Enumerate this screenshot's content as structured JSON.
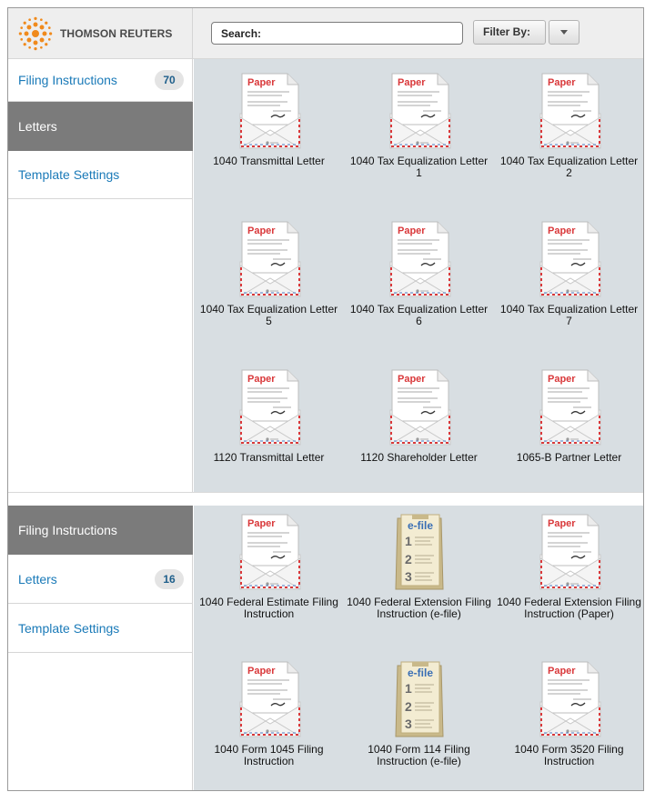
{
  "header": {
    "logo_text": "THOMSON REUTERS",
    "search_label": "Search:",
    "filter_label": "Filter By:"
  },
  "panel1": {
    "sidebar": [
      {
        "label": "Filing Instructions",
        "count": "70",
        "active": false
      },
      {
        "label": "Letters",
        "count": "",
        "active": true
      },
      {
        "label": "Template Settings",
        "count": "",
        "active": false
      }
    ],
    "tiles": [
      {
        "label": "1040 Transmittal Letter",
        "icon": "paper"
      },
      {
        "label": "1040 Tax Equalization Letter 1",
        "icon": "paper"
      },
      {
        "label": "1040 Tax Equalization Letter 2",
        "icon": "paper"
      },
      {
        "label": "1040 Tax Equalization Letter 5",
        "icon": "paper"
      },
      {
        "label": "1040 Tax Equalization Letter 6",
        "icon": "paper"
      },
      {
        "label": "1040 Tax Equalization Letter 7",
        "icon": "paper"
      },
      {
        "label": "1120 Transmittal Letter",
        "icon": "paper"
      },
      {
        "label": "1120 Shareholder Letter",
        "icon": "paper"
      },
      {
        "label": "1065-B Partner Letter",
        "icon": "paper"
      }
    ]
  },
  "panel2": {
    "sidebar": [
      {
        "label": "Filing Instructions",
        "count": "",
        "active": true
      },
      {
        "label": "Letters",
        "count": "16",
        "active": false
      },
      {
        "label": "Template Settings",
        "count": "",
        "active": false
      }
    ],
    "tiles": [
      {
        "label": "1040 Federal Estimate Filing Instruction",
        "icon": "paper"
      },
      {
        "label": "1040 Federal Extension Filing Instruction (e-file)",
        "icon": "efile"
      },
      {
        "label": "1040 Federal Extension Filing Instruction (Paper)",
        "icon": "paper"
      },
      {
        "label": "1040 Form 1045 Filing Instruction",
        "icon": "paper"
      },
      {
        "label": "1040 Form 114 Filing Instruction (e-file)",
        "icon": "efile"
      },
      {
        "label": "1040 Form 3520 Filing Instruction",
        "icon": "paper"
      }
    ]
  },
  "icons": {
    "paper_word": "Paper",
    "efile_word": "e-file",
    "efile_steps": [
      "1",
      "2",
      "3"
    ]
  },
  "colors": {
    "accent_link": "#1a7ab8",
    "active_bg": "#7b7b7b",
    "content_bg": "#d8dee2",
    "paper_red": "#d9383a",
    "efile_blue": "#3a6fb5",
    "logo_orange": "#f08a1c"
  }
}
